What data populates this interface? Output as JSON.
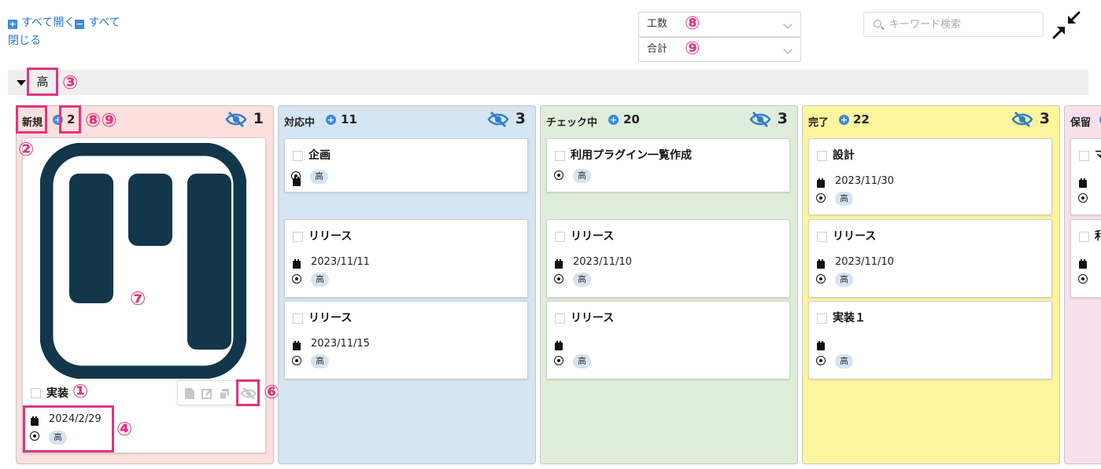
{
  "toolbar": {
    "expand_all": "すべて開く",
    "collapse_all_1": "すべて",
    "collapse_all_2": "閉じる",
    "select_1": "工数",
    "select_2": "合計",
    "search_placeholder": "キーワード検索"
  },
  "group": {
    "label": "高"
  },
  "annotations": {
    "a1": "①",
    "a2": "②",
    "a3": "③",
    "a4": "④",
    "a6": "⑥",
    "a7": "⑦",
    "a8": "⑧",
    "a9": "⑨",
    "a89": "⑧⑨"
  },
  "columns": [
    {
      "title": "新規",
      "count": "2",
      "hidden": "1",
      "color": "#fbe0dd",
      "cards": [
        {
          "title": "実装",
          "date": "2024/2/29",
          "priority": "高"
        }
      ]
    },
    {
      "title": "対応中",
      "count": "11",
      "hidden": "3",
      "color": "#d5e5f2",
      "cards": [
        {
          "title": "企画",
          "date": "",
          "priority": "高"
        },
        {
          "title": "リリース",
          "date": "2023/11/11",
          "priority": "高"
        },
        {
          "title": "リリース",
          "date": "2023/11/15",
          "priority": "高"
        }
      ]
    },
    {
      "title": "チェック中",
      "count": "20",
      "hidden": "3",
      "color": "#dfeedb",
      "cards": [
        {
          "title": "利用プラグイン一覧作成",
          "date": "",
          "priority": "高"
        },
        {
          "title": "リリース",
          "date": "2023/11/10",
          "priority": "高"
        },
        {
          "title": "リリース",
          "date": "",
          "priority": "高"
        }
      ]
    },
    {
      "title": "完了",
      "count": "22",
      "hidden": "3",
      "color": "#fdf49e",
      "cards": [
        {
          "title": "設計",
          "date": "2023/11/30",
          "priority": "高"
        },
        {
          "title": "リリース",
          "date": "2023/11/10",
          "priority": "高"
        },
        {
          "title": "実装１",
          "date": "",
          "priority": "高"
        }
      ]
    },
    {
      "title": "保留",
      "count": "",
      "hidden": "",
      "color": "#f9e1ec",
      "cards": [
        {
          "title": "マ",
          "date": "",
          "priority": ""
        },
        {
          "title": "利",
          "date": "",
          "priority": ""
        }
      ]
    }
  ]
}
